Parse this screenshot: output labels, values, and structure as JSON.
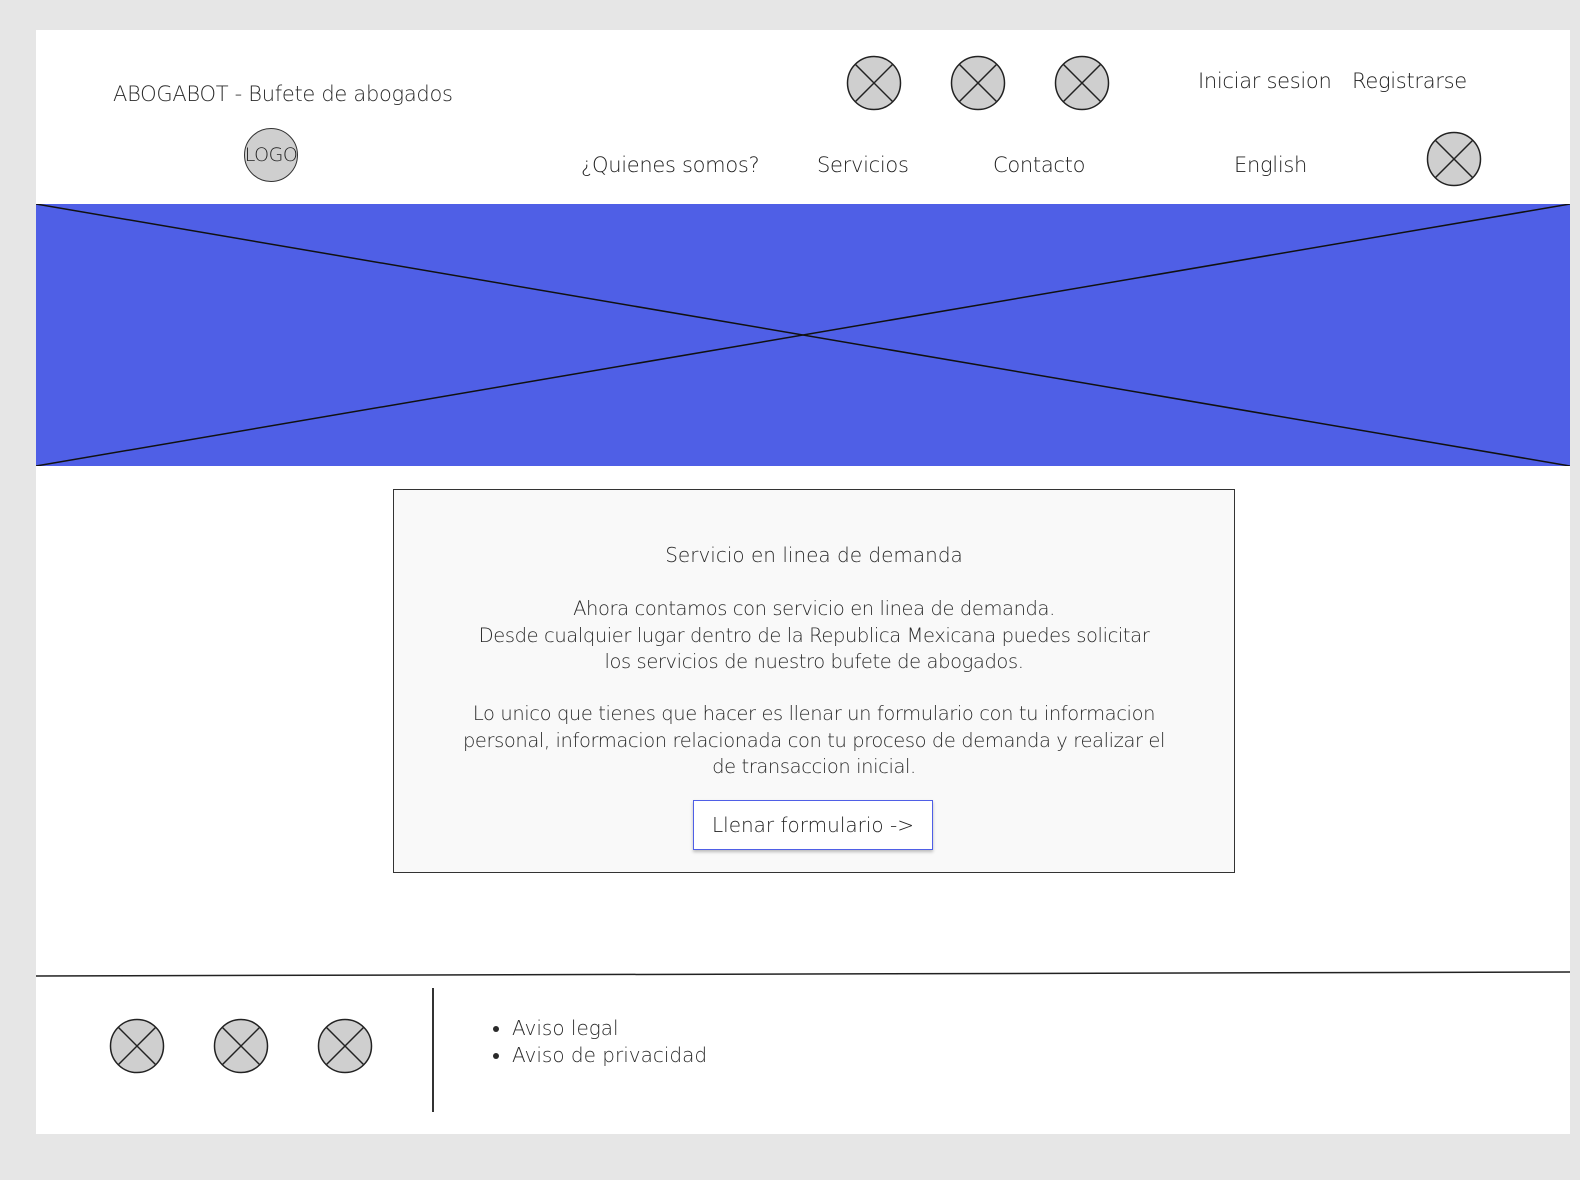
{
  "header": {
    "brand": "ABOGABOT - Bufete de abogados",
    "logo_label": "LOGO",
    "login": "Iniciar sesion",
    "register": "Registrarse",
    "nav": [
      {
        "label": "¿Quienes somos?"
      },
      {
        "label": "Servicios"
      },
      {
        "label": "Contacto"
      },
      {
        "label": "English"
      }
    ],
    "social_icons": [
      "placeholder-image-icon",
      "placeholder-image-icon",
      "placeholder-image-icon"
    ],
    "menu_icon": "placeholder-image-icon"
  },
  "hero": {
    "image": "placeholder-image",
    "color": "#4f5fe6"
  },
  "card": {
    "title": "Servicio en linea de demanda",
    "paragraph1": [
      "Ahora contamos con servicio en linea de demanda.",
      "Desde cualquier lugar dentro de la Republica Mexicana puedes solicitar",
      "los servicios de nuestro bufete de abogados."
    ],
    "paragraph2": [
      "Lo unico que tienes que hacer es llenar un formulario con tu informacion",
      "personal, informacion relacionada con tu proceso de demanda y realizar el",
      "de transaccion inicial."
    ],
    "cta_label": "Llenar formulario ->",
    "cta_border_color": "#4f5fe6"
  },
  "footer": {
    "social_icons": [
      "placeholder-image-icon",
      "placeholder-image-icon",
      "placeholder-image-icon"
    ],
    "links": [
      {
        "label": "Aviso legal"
      },
      {
        "label": "Aviso de privacidad"
      }
    ]
  }
}
